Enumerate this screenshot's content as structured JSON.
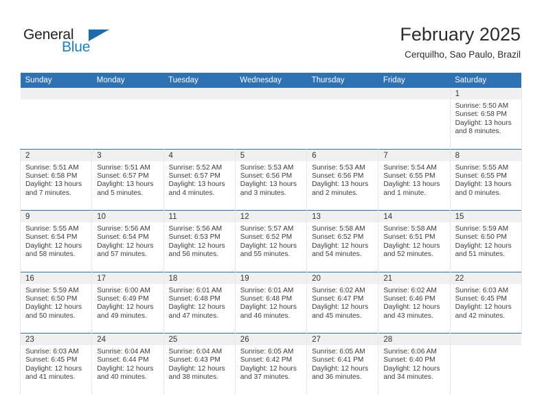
{
  "brand": {
    "name_top": "General",
    "name_bottom": "Blue",
    "triangle_color": "#1b6cb0",
    "blue_color": "#1d7cc4"
  },
  "header": {
    "title": "February 2025",
    "location": "Cerquilho, Sao Paulo, Brazil"
  },
  "theme": {
    "header_blue": "#2e72b3",
    "daynum_band": "#f0f0f0",
    "grid_line": "#e6e6e6"
  },
  "weekday_headers": [
    "Sunday",
    "Monday",
    "Tuesday",
    "Wednesday",
    "Thursday",
    "Friday",
    "Saturday"
  ],
  "weeks": [
    [
      {
        "day": "",
        "lines": []
      },
      {
        "day": "",
        "lines": []
      },
      {
        "day": "",
        "lines": []
      },
      {
        "day": "",
        "lines": []
      },
      {
        "day": "",
        "lines": []
      },
      {
        "day": "",
        "lines": []
      },
      {
        "day": "1",
        "lines": [
          "Sunrise: 5:50 AM",
          "Sunset: 6:58 PM",
          "Daylight: 13 hours",
          "and 8 minutes."
        ]
      }
    ],
    [
      {
        "day": "2",
        "lines": [
          "Sunrise: 5:51 AM",
          "Sunset: 6:58 PM",
          "Daylight: 13 hours",
          "and 7 minutes."
        ]
      },
      {
        "day": "3",
        "lines": [
          "Sunrise: 5:51 AM",
          "Sunset: 6:57 PM",
          "Daylight: 13 hours",
          "and 5 minutes."
        ]
      },
      {
        "day": "4",
        "lines": [
          "Sunrise: 5:52 AM",
          "Sunset: 6:57 PM",
          "Daylight: 13 hours",
          "and 4 minutes."
        ]
      },
      {
        "day": "5",
        "lines": [
          "Sunrise: 5:53 AM",
          "Sunset: 6:56 PM",
          "Daylight: 13 hours",
          "and 3 minutes."
        ]
      },
      {
        "day": "6",
        "lines": [
          "Sunrise: 5:53 AM",
          "Sunset: 6:56 PM",
          "Daylight: 13 hours",
          "and 2 minutes."
        ]
      },
      {
        "day": "7",
        "lines": [
          "Sunrise: 5:54 AM",
          "Sunset: 6:55 PM",
          "Daylight: 13 hours",
          "and 1 minute."
        ]
      },
      {
        "day": "8",
        "lines": [
          "Sunrise: 5:55 AM",
          "Sunset: 6:55 PM",
          "Daylight: 13 hours",
          "and 0 minutes."
        ]
      }
    ],
    [
      {
        "day": "9",
        "lines": [
          "Sunrise: 5:55 AM",
          "Sunset: 6:54 PM",
          "Daylight: 12 hours",
          "and 58 minutes."
        ]
      },
      {
        "day": "10",
        "lines": [
          "Sunrise: 5:56 AM",
          "Sunset: 6:54 PM",
          "Daylight: 12 hours",
          "and 57 minutes."
        ]
      },
      {
        "day": "11",
        "lines": [
          "Sunrise: 5:56 AM",
          "Sunset: 6:53 PM",
          "Daylight: 12 hours",
          "and 56 minutes."
        ]
      },
      {
        "day": "12",
        "lines": [
          "Sunrise: 5:57 AM",
          "Sunset: 6:52 PM",
          "Daylight: 12 hours",
          "and 55 minutes."
        ]
      },
      {
        "day": "13",
        "lines": [
          "Sunrise: 5:58 AM",
          "Sunset: 6:52 PM",
          "Daylight: 12 hours",
          "and 54 minutes."
        ]
      },
      {
        "day": "14",
        "lines": [
          "Sunrise: 5:58 AM",
          "Sunset: 6:51 PM",
          "Daylight: 12 hours",
          "and 52 minutes."
        ]
      },
      {
        "day": "15",
        "lines": [
          "Sunrise: 5:59 AM",
          "Sunset: 6:50 PM",
          "Daylight: 12 hours",
          "and 51 minutes."
        ]
      }
    ],
    [
      {
        "day": "16",
        "lines": [
          "Sunrise: 5:59 AM",
          "Sunset: 6:50 PM",
          "Daylight: 12 hours",
          "and 50 minutes."
        ]
      },
      {
        "day": "17",
        "lines": [
          "Sunrise: 6:00 AM",
          "Sunset: 6:49 PM",
          "Daylight: 12 hours",
          "and 49 minutes."
        ]
      },
      {
        "day": "18",
        "lines": [
          "Sunrise: 6:01 AM",
          "Sunset: 6:48 PM",
          "Daylight: 12 hours",
          "and 47 minutes."
        ]
      },
      {
        "day": "19",
        "lines": [
          "Sunrise: 6:01 AM",
          "Sunset: 6:48 PM",
          "Daylight: 12 hours",
          "and 46 minutes."
        ]
      },
      {
        "day": "20",
        "lines": [
          "Sunrise: 6:02 AM",
          "Sunset: 6:47 PM",
          "Daylight: 12 hours",
          "and 45 minutes."
        ]
      },
      {
        "day": "21",
        "lines": [
          "Sunrise: 6:02 AM",
          "Sunset: 6:46 PM",
          "Daylight: 12 hours",
          "and 43 minutes."
        ]
      },
      {
        "day": "22",
        "lines": [
          "Sunrise: 6:03 AM",
          "Sunset: 6:45 PM",
          "Daylight: 12 hours",
          "and 42 minutes."
        ]
      }
    ],
    [
      {
        "day": "23",
        "lines": [
          "Sunrise: 6:03 AM",
          "Sunset: 6:45 PM",
          "Daylight: 12 hours",
          "and 41 minutes."
        ]
      },
      {
        "day": "24",
        "lines": [
          "Sunrise: 6:04 AM",
          "Sunset: 6:44 PM",
          "Daylight: 12 hours",
          "and 40 minutes."
        ]
      },
      {
        "day": "25",
        "lines": [
          "Sunrise: 6:04 AM",
          "Sunset: 6:43 PM",
          "Daylight: 12 hours",
          "and 38 minutes."
        ]
      },
      {
        "day": "26",
        "lines": [
          "Sunrise: 6:05 AM",
          "Sunset: 6:42 PM",
          "Daylight: 12 hours",
          "and 37 minutes."
        ]
      },
      {
        "day": "27",
        "lines": [
          "Sunrise: 6:05 AM",
          "Sunset: 6:41 PM",
          "Daylight: 12 hours",
          "and 36 minutes."
        ]
      },
      {
        "day": "28",
        "lines": [
          "Sunrise: 6:06 AM",
          "Sunset: 6:40 PM",
          "Daylight: 12 hours",
          "and 34 minutes."
        ]
      },
      {
        "day": "",
        "lines": []
      }
    ]
  ]
}
